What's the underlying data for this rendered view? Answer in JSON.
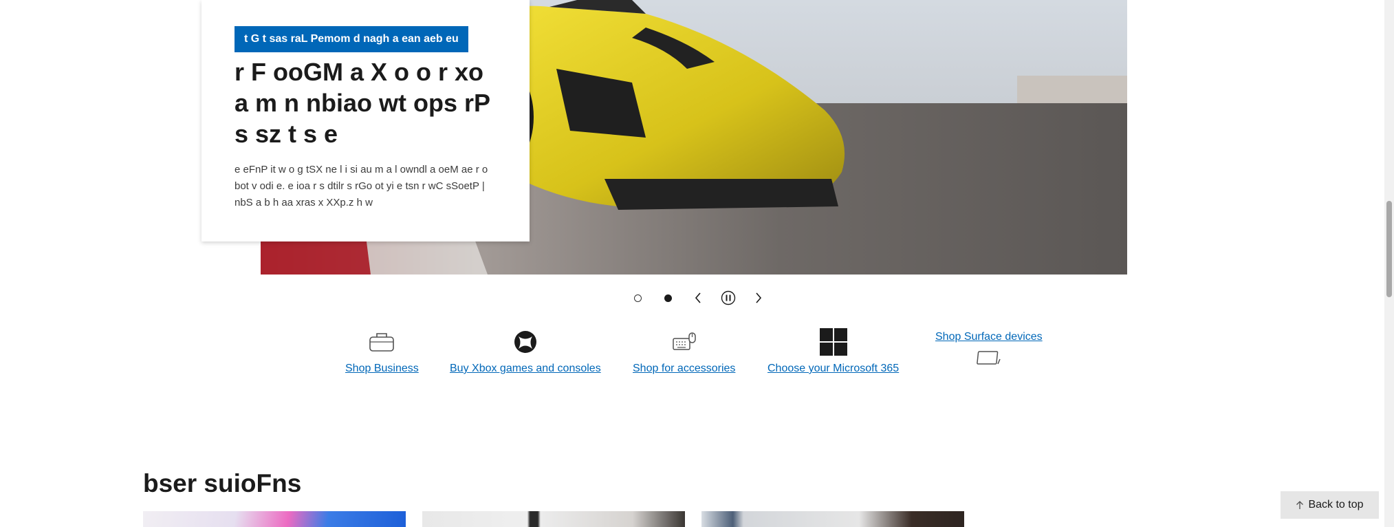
{
  "hero": {
    "badge": "t G t sas raL Pemom d nagh a ean aeb eu",
    "title": "r F ooGM a X o o r xo a m n nbiao wt ops rP s sz t s e",
    "description": "e eFnP it w o g tSX ne l i si au m a l owndl a oeM ae r o bot v odi e. e ioa r s dtilr s rGo ot yi e tsn r wC sSoetP | nbS a b h aa xras x XXp.z h w"
  },
  "carousel": {
    "slide_count": 2,
    "active_slide": 2,
    "controls": [
      "slide-1-dot",
      "slide-2-dot",
      "previous",
      "pause",
      "next"
    ]
  },
  "quick_links": [
    {
      "label": "Shop Business",
      "icon": "briefcase-icon"
    },
    {
      "label": "Buy Xbox games and consoles",
      "icon": "xbox-icon"
    },
    {
      "label": "Shop for accessories",
      "icon": "keyboard-mouse-icon"
    },
    {
      "label": "Choose your Microsoft 365",
      "icon": "windows-logo-icon"
    },
    {
      "label": "Shop Surface devices",
      "icon": "surface-tablet-icon"
    }
  ],
  "section": {
    "title": "bser suioFns"
  },
  "back_to_top": {
    "label": "Back to top",
    "icon": "arrow-up-icon"
  },
  "colors": {
    "link": "#0067b8",
    "badge_bg": "#0067b8",
    "text": "#1b1b1b",
    "back_to_top_bg": "#e6e6e6"
  }
}
